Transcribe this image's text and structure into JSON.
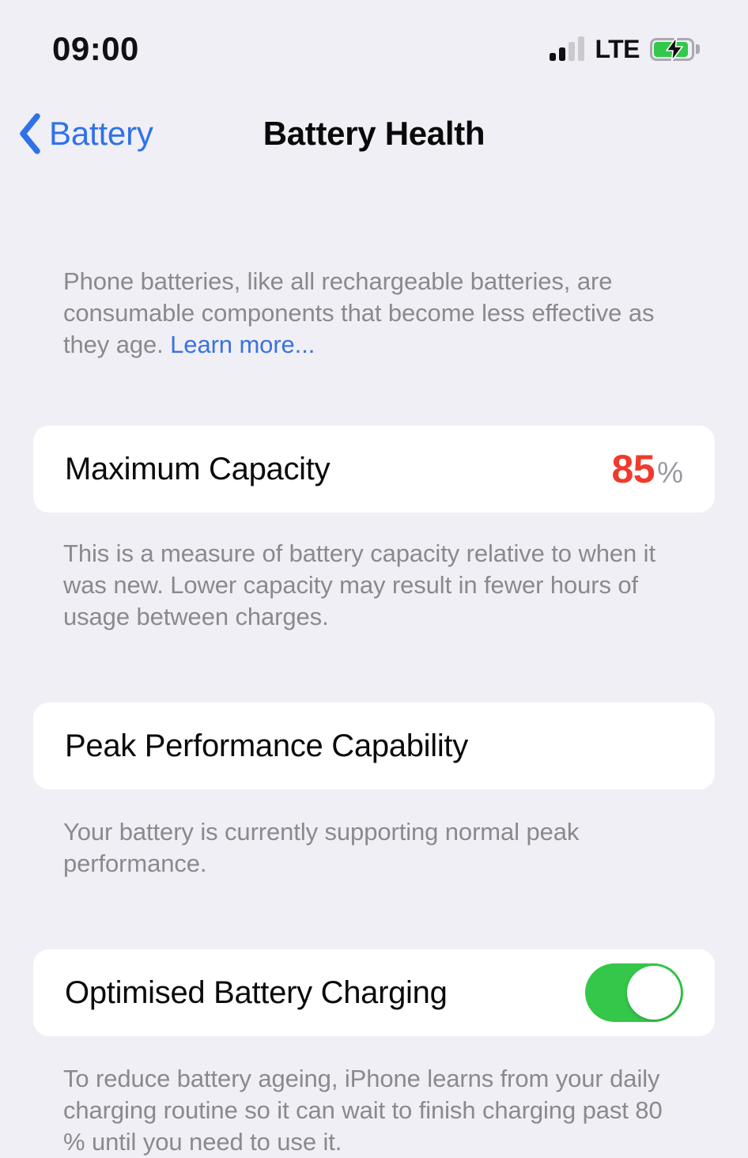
{
  "status_bar": {
    "time": "09:00",
    "network_label": "LTE",
    "signal_bars_filled": 2,
    "signal_bars_total": 4,
    "battery_level_percent": 85,
    "battery_charging": true,
    "icons": {
      "signal": "cellular-signal-icon",
      "battery": "battery-charging-icon"
    }
  },
  "nav": {
    "back_label": "Battery",
    "back_icon": "chevron-left-icon",
    "title": "Battery Health"
  },
  "intro": {
    "text": "Phone batteries, like all rechargeable batteries, are consumable components that become less effective as they age. ",
    "link_label": "Learn more..."
  },
  "capacity": {
    "label": "Maximum Capacity",
    "value": "85",
    "unit": "%",
    "note": "This is a measure of battery capacity relative to when it was new. Lower capacity may result in fewer hours of usage between charges."
  },
  "peak_performance": {
    "label": "Peak Performance Capability",
    "note": "Your battery is currently supporting normal peak performance."
  },
  "optimised_charging": {
    "label": "Optimised Battery Charging",
    "toggle_state": "on",
    "note": "To reduce battery ageing, iPhone learns from your daily charging routine so it can wait to finish charging past 80 % until you need to use it."
  },
  "colors": {
    "background": "#f0eff5",
    "card": "#ffffff",
    "accent_blue": "#2f72e8",
    "warning_red": "#f03a2c",
    "toggle_green": "#34c749",
    "secondary_text": "#8a8a8e"
  }
}
